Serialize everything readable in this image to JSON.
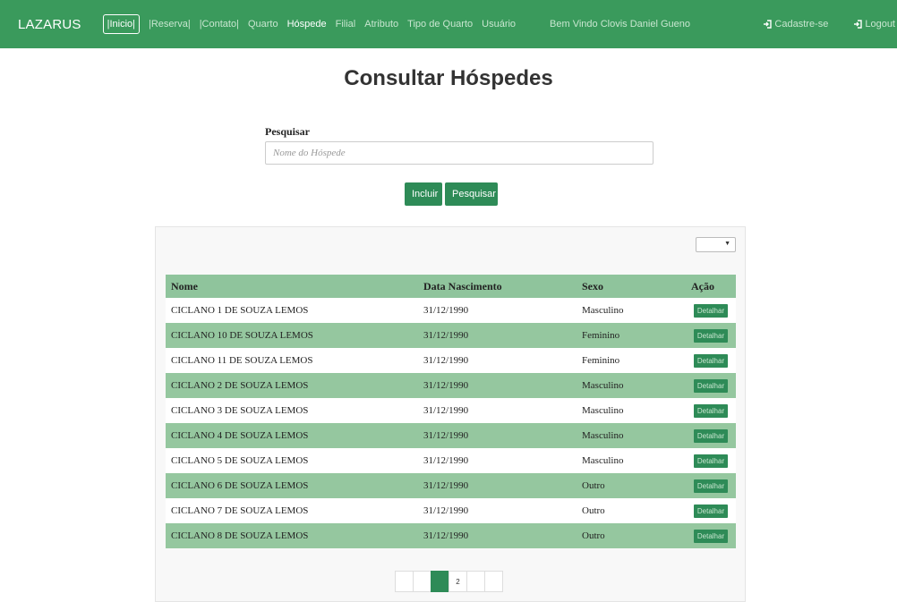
{
  "navbar": {
    "brand": "LAZARUS",
    "items": [
      {
        "label": "|Inicio|"
      },
      {
        "label": "|Reserva|"
      },
      {
        "label": "|Contato|"
      },
      {
        "label": "Quarto"
      },
      {
        "label": "Hóspede"
      },
      {
        "label": "Filial"
      },
      {
        "label": "Atributo"
      },
      {
        "label": "Tipo de Quarto"
      },
      {
        "label": "Usuário"
      }
    ],
    "welcome": "Bem Vindo Clovis Daniel Gueno",
    "signup": "Cadastre-se",
    "logout": "Logout"
  },
  "page": {
    "title": "Consultar Hóspedes"
  },
  "search": {
    "label": "Pesquisar",
    "placeholder": "Nome do Hóspede",
    "value": ""
  },
  "actions": {
    "incluir": "Incluir",
    "pesquisar": "Pesquisar"
  },
  "table": {
    "headers": {
      "nome": "Nome",
      "data": "Data Nascimento",
      "sexo": "Sexo",
      "acao": "Ação"
    },
    "action_label": "Detalhar",
    "rows": [
      {
        "nome": "CICLANO 1 DE SOUZA LEMOS",
        "data": "31/12/1990",
        "sexo": "Masculino"
      },
      {
        "nome": "CICLANO 10 DE SOUZA LEMOS",
        "data": "31/12/1990",
        "sexo": "Feminino"
      },
      {
        "nome": "CICLANO 11 DE SOUZA LEMOS",
        "data": "31/12/1990",
        "sexo": "Feminino"
      },
      {
        "nome": "CICLANO 2 DE SOUZA LEMOS",
        "data": "31/12/1990",
        "sexo": "Masculino"
      },
      {
        "nome": "CICLANO 3 DE SOUZA LEMOS",
        "data": "31/12/1990",
        "sexo": "Masculino"
      },
      {
        "nome": "CICLANO 4 DE SOUZA LEMOS",
        "data": "31/12/1990",
        "sexo": "Masculino"
      },
      {
        "nome": "CICLANO 5 DE SOUZA LEMOS",
        "data": "31/12/1990",
        "sexo": "Masculino"
      },
      {
        "nome": "CICLANO 6 DE SOUZA LEMOS",
        "data": "31/12/1990",
        "sexo": "Outro"
      },
      {
        "nome": "CICLANO 7 DE SOUZA LEMOS",
        "data": "31/12/1990",
        "sexo": "Outro"
      },
      {
        "nome": "CICLANO 8 DE SOUZA LEMOS",
        "data": "31/12/1990",
        "sexo": "Outro"
      }
    ]
  },
  "pagination": {
    "pages": [
      "",
      "",
      "",
      "2",
      "",
      ""
    ],
    "active_index": 2
  },
  "colors": {
    "navbar": "#3a9a5c",
    "button": "#2e8b57",
    "row_alt": "#95c79f",
    "header": "#8fc49c"
  },
  "icons": {
    "signup": "login-icon",
    "logout": "login-icon",
    "select_caret": "caret-down-icon"
  }
}
